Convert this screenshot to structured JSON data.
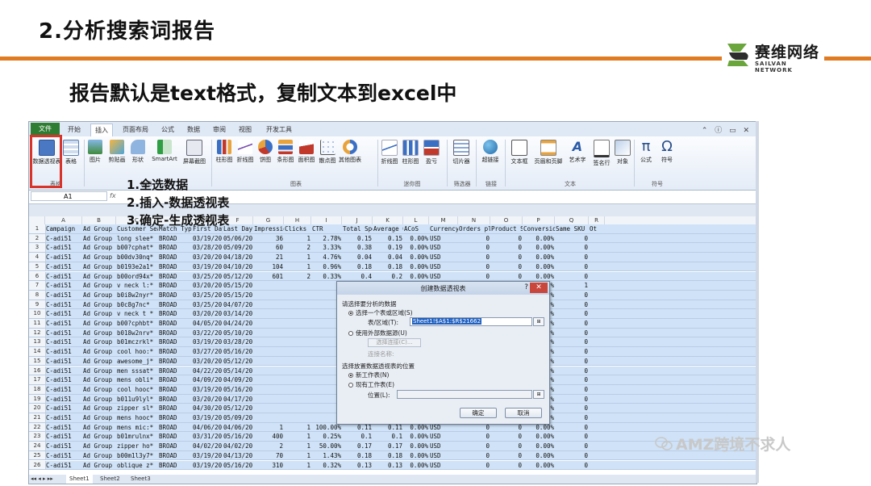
{
  "slide": {
    "title": "2.分析搜索词报告",
    "subtitle": "报告默认是text格式，复制文本到excel中",
    "logo_cn": "赛维网络",
    "logo_en": "SAILVAN NETWORK",
    "watermark": "AMZ跨境不求人",
    "accent_color": "#e07b22"
  },
  "steps": [
    "1.全选数据",
    "2.插入-数据透视表",
    "3.确定-生成透视表"
  ],
  "excel": {
    "tabs": [
      "文件",
      "开始",
      "插入",
      "页面布局",
      "公式",
      "数据",
      "审阅",
      "视图",
      "开发工具"
    ],
    "active_tab": "插入",
    "ribbon_buttons": [
      "数据透视表",
      "表格",
      "图片",
      "剪贴画",
      "形状",
      "SmartArt",
      "屏幕截图",
      "柱形图",
      "折线图",
      "饼图",
      "条形图",
      "面积图",
      "散点图",
      "其他图表",
      "折线图",
      "柱形图",
      "盈亏",
      "切片器",
      "超链接",
      "文本框",
      "页眉和页脚",
      "艺术字",
      "签名行",
      "对象",
      "公式",
      "符号"
    ],
    "ribbon_groups": [
      "表格",
      "插图",
      "图表",
      "迷你图",
      "筛选器",
      "链接",
      "文本",
      "符号"
    ],
    "name_box": "A1",
    "columns": [
      "A",
      "B",
      "C",
      "D",
      "E",
      "F",
      "G",
      "H",
      "I",
      "J",
      "K",
      "L",
      "M",
      "N",
      "O",
      "P",
      "Q",
      "R"
    ],
    "header_row": [
      "Campaign",
      "Ad Group",
      "Customer Search Keyword",
      "Match Type",
      "First Day",
      "Last Day",
      "Impressions",
      "Clicks",
      "CTR",
      "Total Spend",
      "Average CPC",
      "ACoS",
      "Currency",
      "Orders placed",
      "Product Sales",
      "Conversion",
      "Same SKU Units",
      "Ot"
    ],
    "rows": [
      [
        "C-adi51",
        "Ad Group",
        "long slee*",
        "BROAD",
        "03/19/2016",
        "05/06/201",
        "36",
        "1",
        "2.78%",
        "0.15",
        "0.15",
        "0.00%",
        "USD",
        "0",
        "0",
        "0.00%",
        "0"
      ],
      [
        "C-adi51",
        "Ad Group",
        "b00?cphat*",
        "BROAD",
        "03/28/2016",
        "05/09/201",
        "60",
        "2",
        "3.33%",
        "0.38",
        "0.19",
        "0.00%",
        "USD",
        "0",
        "0",
        "0.00%",
        "0"
      ],
      [
        "C-adi51",
        "Ad Group",
        "b00dv30nq*",
        "BROAD",
        "03/20/2016",
        "04/18/201",
        "21",
        "1",
        "4.76%",
        "0.04",
        "0.04",
        "0.00%",
        "USD",
        "0",
        "0",
        "0.00%",
        "0"
      ],
      [
        "C-adi51",
        "Ad Group",
        "b0193e2a1*",
        "BROAD",
        "03/19/2016",
        "04/10/201",
        "104",
        "1",
        "0.96%",
        "0.18",
        "0.18",
        "0.00%",
        "USD",
        "0",
        "0",
        "0.00%",
        "0"
      ],
      [
        "C-adi51",
        "Ad Group",
        "b00ord94x*",
        "BROAD",
        "03/25/2016",
        "05/12/201",
        "601",
        "2",
        "0.33%",
        "0.4",
        "0.2",
        "0.00%",
        "USD",
        "0",
        "0",
        "0.00%",
        "0"
      ],
      [
        "C-adi51",
        "Ad Group",
        "v neck l:*",
        "BROAD",
        "03/20/2016",
        "05/15/201",
        "",
        "",
        "",
        "",
        "",
        "",
        "",
        "1",
        "16.99",
        "100.00%",
        "1"
      ],
      [
        "C-adi51",
        "Ad Group",
        "b0i8w2nyr*",
        "BROAD",
        "03/25/2016",
        "05/15/201",
        "",
        "",
        "",
        "",
        "",
        "",
        "",
        "0",
        "0",
        "0.00%",
        "0"
      ],
      [
        "C-adi51",
        "Ad Group",
        "b0c8g7nc*",
        "BROAD",
        "03/25/2016",
        "04/07/201",
        "",
        "",
        "",
        "",
        "",
        "",
        "",
        "0",
        "0",
        "0.00%",
        "0"
      ],
      [
        "C-adi51",
        "Ad Group",
        "v neck t *",
        "BROAD",
        "03/20/2016",
        "03/14/201",
        "",
        "",
        "",
        "",
        "",
        "",
        "",
        "0",
        "0",
        "0.00%",
        "0"
      ],
      [
        "C-adi51",
        "Ad Group",
        "b00?cphbt*",
        "BROAD",
        "04/05/2016",
        "04/24/201",
        "",
        "",
        "",
        "",
        "",
        "",
        "",
        "0",
        "0",
        "0.00%",
        "0"
      ],
      [
        "C-adi51",
        "Ad Group",
        "b018w2nrv*",
        "BROAD",
        "03/22/2016",
        "05/10/201",
        "",
        "",
        "",
        "",
        "",
        "",
        "",
        "0",
        "0",
        "0.00%",
        "0"
      ],
      [
        "C-adi51",
        "Ad Group",
        "b01mczrkl*",
        "BROAD",
        "03/19/2016",
        "03/28/201",
        "",
        "",
        "",
        "",
        "",
        "",
        "",
        "0",
        "0",
        "0.00%",
        "0"
      ],
      [
        "C-adi51",
        "Ad Group",
        "cool hoo:*",
        "BROAD",
        "03/27/2016",
        "05/16/201",
        "",
        "",
        "",
        "",
        "",
        "",
        "",
        "0",
        "0",
        "0.00%",
        "0"
      ],
      [
        "C-adi51",
        "Ad Group",
        "awesome_j*",
        "BROAD",
        "03/20/2016",
        "05/12/201",
        "",
        "",
        "",
        "",
        "",
        "",
        "",
        "0",
        "0",
        "0.00%",
        "0"
      ],
      [
        "C-adi51",
        "Ad Group",
        "men sssat*",
        "BROAD",
        "04/22/2016",
        "05/14/201",
        "",
        "",
        "",
        "",
        "",
        "",
        "",
        "0",
        "0",
        "0.00%",
        "0"
      ],
      [
        "C-adi51",
        "Ad Group",
        "mens obli*",
        "BROAD",
        "04/09/2016",
        "04/09/201",
        "",
        "",
        "",
        "",
        "",
        "",
        "",
        "0",
        "0",
        "0.00%",
        "0"
      ],
      [
        "C-adi51",
        "Ad Group",
        "cool hooc*",
        "BROAD",
        "03/19/2016",
        "05/16/201",
        "",
        "",
        "",
        "",
        "",
        "",
        "",
        "0",
        "0",
        "0.00%",
        "0"
      ],
      [
        "C-adi51",
        "Ad Group",
        "b011u9lyl*",
        "BROAD",
        "03/20/2016",
        "04/17/201",
        "",
        "",
        "",
        "",
        "",
        "",
        "",
        "0",
        "0",
        "0.00%",
        "0"
      ],
      [
        "C-adi51",
        "Ad Group",
        "zipper sl*",
        "BROAD",
        "04/30/2016",
        "05/12/201",
        "",
        "",
        "",
        "",
        "",
        "",
        "",
        "0",
        "0",
        "0.00%",
        "0"
      ],
      [
        "C-adi51",
        "Ad Group",
        "mens hooc*",
        "BROAD",
        "03/19/2016",
        "05/09/201",
        "",
        "",
        "",
        "",
        "",
        "",
        "",
        "0",
        "0",
        "0.00%",
        "0"
      ],
      [
        "C-adi51",
        "Ad Group",
        "mens mic:*",
        "BROAD",
        "04/06/2016",
        "04/06/201",
        "1",
        "1",
        "100.00%",
        "0.11",
        "0.11",
        "0.00%",
        "USD",
        "0",
        "0",
        "0.00%",
        "0"
      ],
      [
        "C-adi51",
        "Ad Group",
        "b01mrulnx*",
        "BROAD",
        "03/31/2016",
        "05/16/201",
        "400",
        "1",
        "0.25%",
        "0.1",
        "0.1",
        "0.00%",
        "USD",
        "0",
        "0",
        "0.00%",
        "0"
      ],
      [
        "C-adi51",
        "Ad Group",
        "zipper ho*",
        "BROAD",
        "04/02/2016",
        "04/02/201",
        "2",
        "1",
        "50.00%",
        "0.17",
        "0.17",
        "0.00%",
        "USD",
        "0",
        "0",
        "0.00%",
        "0"
      ],
      [
        "C-adi51",
        "Ad Group",
        "b00m1l3y7*",
        "BROAD",
        "03/19/2016",
        "04/13/201",
        "70",
        "1",
        "1.43%",
        "0.18",
        "0.18",
        "0.00%",
        "USD",
        "0",
        "0",
        "0.00%",
        "0"
      ],
      [
        "C-adi51",
        "Ad Group",
        "oblique z*",
        "BROAD",
        "03/19/2016",
        "05/16/201",
        "310",
        "1",
        "0.32%",
        "0.13",
        "0.13",
        "0.00%",
        "USD",
        "0",
        "0",
        "0.00%",
        "0"
      ]
    ],
    "sheet_tabs": [
      "Sheet1",
      "Sheet2",
      "Sheet3"
    ]
  },
  "dialog": {
    "title": "创建数据透视表",
    "help": "?",
    "close": "✕",
    "section1": "请选择要分析的数据",
    "opt_select_table": "选择一个表或区域(S)",
    "range_label": "表/区域(T):",
    "range_value": "Sheet1!$A$1:$R$21662",
    "opt_external": "使用外部数据源(U)",
    "choose_conn": "选择连接(C)...",
    "conn_name": "连接名称:",
    "section2": "选择放置数据透视表的位置",
    "opt_new_sheet": "新工作表(N)",
    "opt_existing": "现有工作表(E)",
    "location_label": "位置(L):",
    "ok": "确定",
    "cancel": "取消"
  }
}
